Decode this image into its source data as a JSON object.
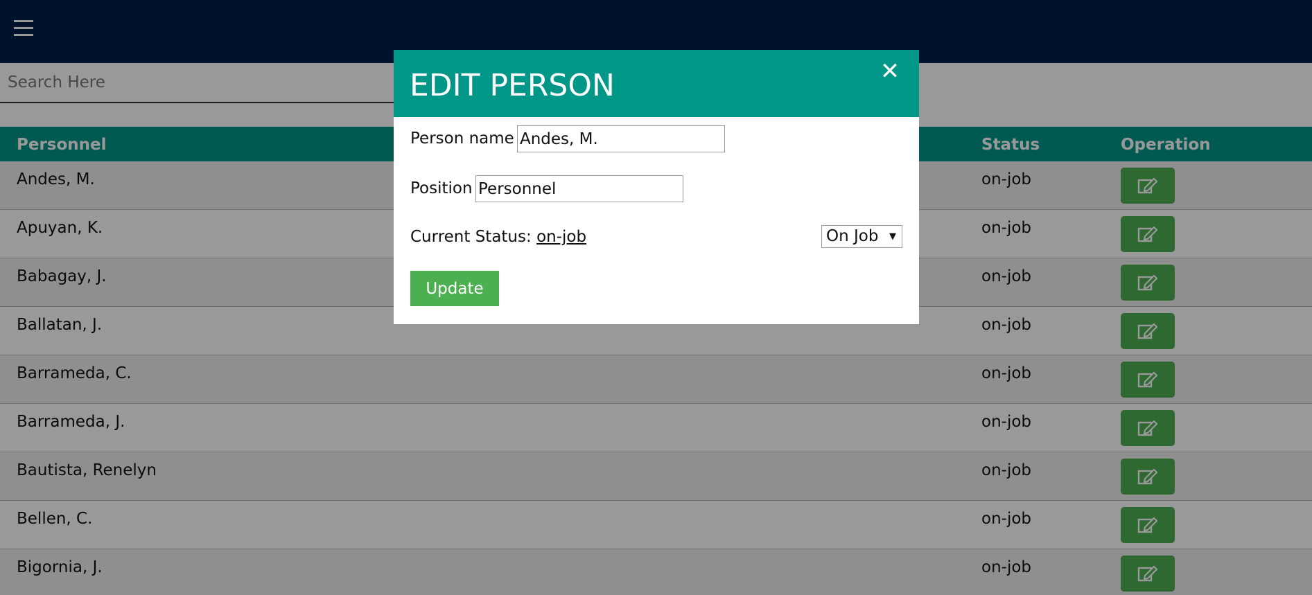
{
  "topbar": {
    "menu_icon": "hamburger-menu-icon"
  },
  "search": {
    "placeholder": "Search Here",
    "value": ""
  },
  "table": {
    "headers": {
      "personnel": "Personnel",
      "status": "Status",
      "operation": "Operation"
    },
    "rows": [
      {
        "name": "Andes, M.",
        "status": "on-job"
      },
      {
        "name": "Apuyan, K.",
        "status": "on-job"
      },
      {
        "name": "Babagay, J.",
        "status": "on-job"
      },
      {
        "name": "Ballatan, J.",
        "status": "on-job"
      },
      {
        "name": "Barrameda, C.",
        "status": "on-job"
      },
      {
        "name": "Barrameda, J.",
        "status": "on-job"
      },
      {
        "name": "Bautista, Renelyn",
        "status": "on-job"
      },
      {
        "name": "Bellen, C.",
        "status": "on-job"
      },
      {
        "name": "Bigornia, J.",
        "status": "on-job"
      }
    ],
    "edit_icon": "edit-pencil-icon"
  },
  "modal": {
    "title": "EDIT PERSON",
    "close_icon": "close-icon",
    "close_glyph": "✕",
    "person_name_label": "Person name",
    "person_name_value": "Andes, M.",
    "position_label": "Position",
    "position_value": "Personnel",
    "current_status_label": "Current Status:",
    "current_status_value": "on-job",
    "status_select_value": "On Job",
    "update_label": "Update"
  },
  "colors": {
    "topbar": "#001f4a",
    "accent": "#009688",
    "button_green": "#4caf50"
  }
}
